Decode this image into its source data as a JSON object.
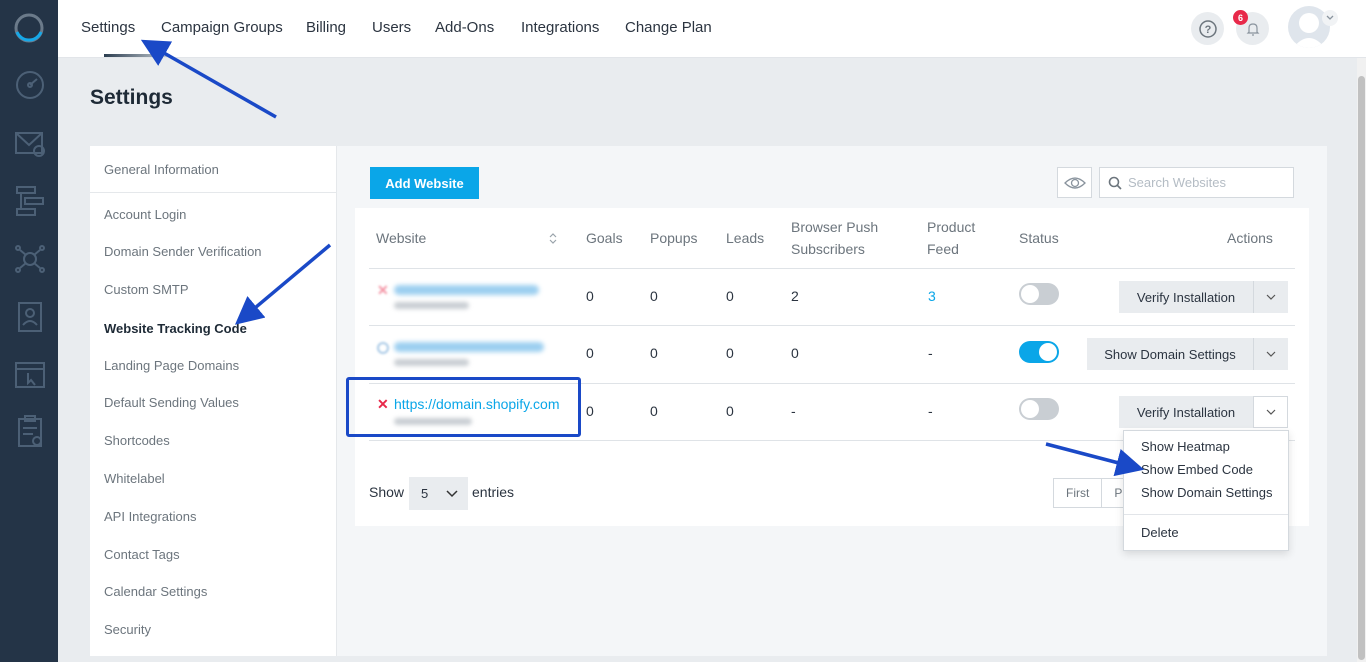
{
  "top_nav": {
    "tabs": [
      "Settings",
      "Campaign Groups",
      "Billing",
      "Users",
      "Add-Ons",
      "Integrations",
      "Change Plan"
    ],
    "notification_count": "6"
  },
  "page": {
    "title": "Settings"
  },
  "settings_menu": {
    "items": [
      "General Information",
      "Account Login",
      "Domain Sender Verification",
      "Custom SMTP",
      "Website Tracking Code",
      "Landing Page Domains",
      "Default Sending Values",
      "Shortcodes",
      "Whitelabel",
      "API Integrations",
      "Contact Tags",
      "Calendar Settings",
      "Security"
    ],
    "active": "Website Tracking Code"
  },
  "toolbar": {
    "add_label": "Add Website",
    "search_placeholder": "Search Websites"
  },
  "table": {
    "headers": {
      "website": "Website",
      "goals": "Goals",
      "popups": "Popups",
      "leads": "Leads",
      "push_1": "Browser Push",
      "push_2": "Subscribers",
      "feed_1": "Product",
      "feed_2": "Feed",
      "status": "Status",
      "actions": "Actions"
    },
    "rows": [
      {
        "website": "",
        "goals": "0",
        "popups": "0",
        "leads": "0",
        "push": "2",
        "feed": "3",
        "status_on": false,
        "action": "Verify Installation"
      },
      {
        "website": "",
        "goals": "0",
        "popups": "0",
        "leads": "0",
        "push": "0",
        "feed": "-",
        "status_on": true,
        "action": "Show Domain Settings"
      },
      {
        "website": "https://domain.shopify.com",
        "goals": "0",
        "popups": "0",
        "leads": "0",
        "push": "-",
        "feed": "-",
        "status_on": false,
        "action": "Verify Installation"
      }
    ]
  },
  "footer": {
    "show_label": "Show",
    "entries_value": "5",
    "entries_label": "entries",
    "pager_first": "First",
    "pager_prev": "Pr"
  },
  "dropdown": {
    "items": [
      "Show Heatmap",
      "Show Embed Code",
      "Show Domain Settings"
    ],
    "delete": "Delete"
  },
  "colors": {
    "accent": "#0aa6e8",
    "rail": "#243447",
    "annotation": "#1a49c7",
    "error": "#e8294a"
  }
}
